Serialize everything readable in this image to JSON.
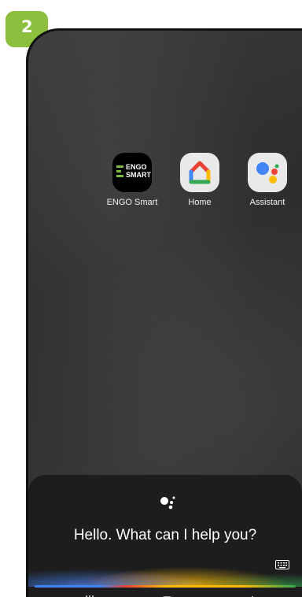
{
  "step": {
    "number": "2",
    "badge_color": "#8dbf3f"
  },
  "home_screen": {
    "apps": [
      {
        "label": "ENGO Smart",
        "icon": "engo-smart-icon",
        "icon_text_line1": "ENGO",
        "icon_text_line2": "SMART",
        "accent": "#7dbb3f"
      },
      {
        "label": "Home",
        "icon": "google-home-icon"
      },
      {
        "label": "Assistant",
        "icon": "google-assistant-icon"
      }
    ]
  },
  "assistant": {
    "prompt": "Hello. What can I help you?",
    "icons": [
      "assistant-dots-icon",
      "keyboard-icon"
    ],
    "colors": [
      "#4285f4",
      "#ea4335",
      "#fbbc05",
      "#34a853"
    ]
  },
  "navigation": {
    "icons": [
      "recent-apps-icon",
      "home-nav-icon",
      "back-icon"
    ]
  }
}
